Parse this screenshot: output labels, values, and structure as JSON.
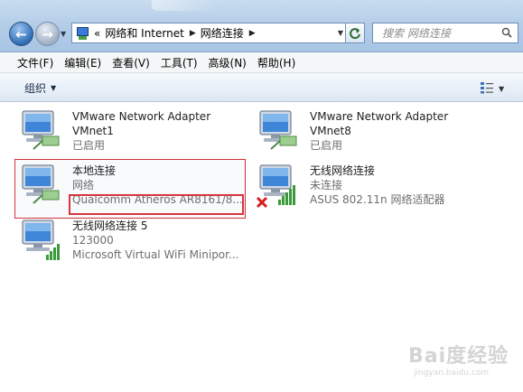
{
  "address_bar": {
    "crumbs_prefix": "«",
    "crumbs": [
      "网络和 Internet",
      "网络连接"
    ]
  },
  "search": {
    "placeholder": "搜索 网络连接"
  },
  "menu": [
    "文件(F)",
    "编辑(E)",
    "查看(V)",
    "工具(T)",
    "高级(N)",
    "帮助(H)"
  ],
  "toolbar": {
    "organize_label": "组织"
  },
  "connections": [
    {
      "name": "VMware Network Adapter",
      "name2": "VMnet1",
      "status": "已启用",
      "device": "",
      "signal": false,
      "disconnected": false
    },
    {
      "name": "VMware Network Adapter",
      "name2": "VMnet8",
      "status": "已启用",
      "device": "",
      "signal": false,
      "disconnected": false
    },
    {
      "name": "本地连接",
      "name2": "",
      "status": "网络",
      "device": "Qualcomm Atheros AR8161/8...",
      "signal": false,
      "disconnected": false
    },
    {
      "name": "无线网络连接",
      "name2": "",
      "status": "未连接",
      "device": "ASUS 802.11n 网络适配器",
      "signal": true,
      "disconnected": true
    },
    {
      "name": "无线网络连接 5",
      "name2": "",
      "status": "123000",
      "device": "Microsoft Virtual WiFi Minipor...",
      "signal": true,
      "disconnected": false
    }
  ],
  "watermark": {
    "logo": "Bai度经验",
    "url": "jingyan.baidu.com"
  },
  "colors": {
    "highlight": "#d9343d",
    "titlebar": "#b3cde8"
  }
}
